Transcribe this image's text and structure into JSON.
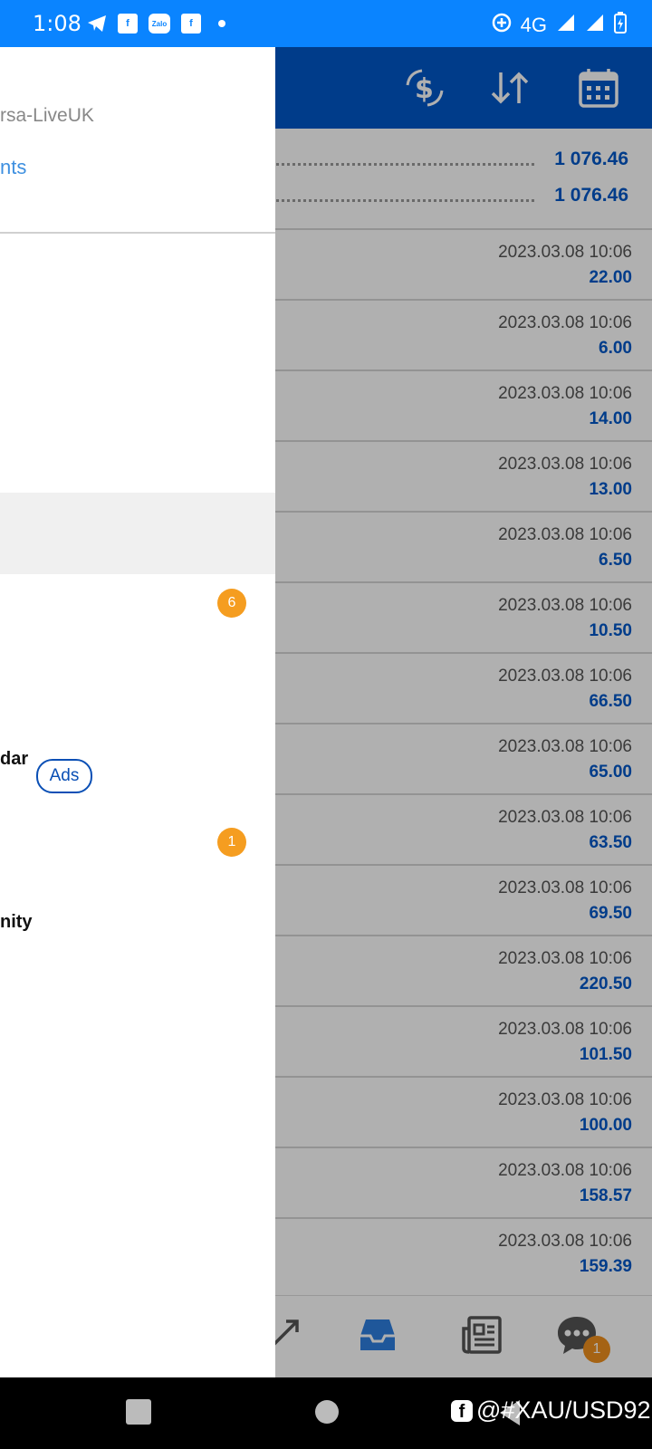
{
  "status_bar": {
    "time": "1:08",
    "icons": [
      "telegram-icon",
      "facebook-icon",
      "zalo-icon",
      "facebook-icon",
      "dot-icon"
    ],
    "zalo_label": "Zalo",
    "network": "4G"
  },
  "header": {
    "icons": [
      "currency-exchange-icon",
      "sort-icon",
      "calendar-icon"
    ]
  },
  "balances": [
    "1 076.46",
    "1 076.46"
  ],
  "deals": [
    {
      "time": "2023.03.08 10:06",
      "profit": "22.00"
    },
    {
      "time": "2023.03.08 10:06",
      "profit": "6.00"
    },
    {
      "time": "2023.03.08 10:06",
      "profit": "14.00"
    },
    {
      "time": "2023.03.08 10:06",
      "profit": "13.00"
    },
    {
      "time": "2023.03.08 10:06",
      "profit": "6.50"
    },
    {
      "time": "2023.03.08 10:06",
      "profit": "10.50"
    },
    {
      "time": "2023.03.08 10:06",
      "profit": "66.50"
    },
    {
      "time": "2023.03.08 10:06",
      "profit": "65.00"
    },
    {
      "time": "2023.03.08 10:06",
      "profit": "63.50"
    },
    {
      "time": "2023.03.08 10:06",
      "profit": "69.50"
    },
    {
      "time": "2023.03.08 10:06",
      "profit": "220.50"
    },
    {
      "time": "2023.03.08 10:06",
      "profit": "101.50"
    },
    {
      "time": "2023.03.08 10:06",
      "profit": "100.00"
    },
    {
      "time": "2023.03.08 10:06",
      "profit": "158.57"
    },
    {
      "time": "2023.03.08 10:06",
      "profit": "159.39"
    }
  ],
  "drawer": {
    "account_server": "rsa-LiveUK",
    "accounts_link": "nts",
    "items": {
      "badge_one": "6",
      "calendar_label": "dar",
      "ads_label": "Ads",
      "badge_two": "1",
      "community_label": "nity"
    }
  },
  "bottom_nav": {
    "icons": [
      "expand-icon",
      "inbox-icon",
      "news-icon",
      "chat-icon"
    ],
    "chat_badge": "1"
  },
  "watermark": {
    "text": "@#XAU/USD92",
    "icon_glyph": "f"
  },
  "colors": {
    "status_bar": "#0a84ff",
    "header": "#0058c8",
    "accent": "#0058c8",
    "badge": "#f59d20"
  }
}
